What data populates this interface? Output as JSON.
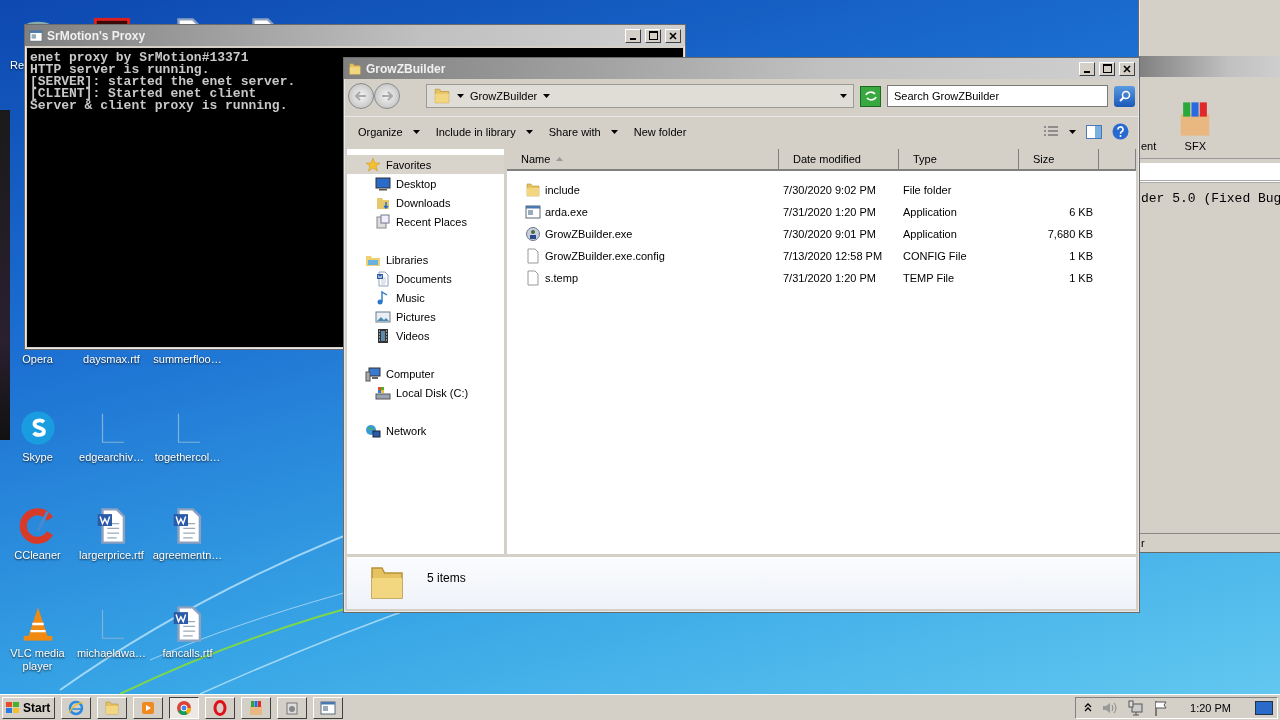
{
  "desktop": {
    "icons": [
      {
        "label": "Re",
        "kind": "recycle-bin"
      },
      {
        "kind": "app-red"
      },
      {
        "kind": "word"
      },
      {
        "kind": "word"
      },
      {
        "label": "Opera"
      },
      {
        "label": "daysmax.rtf"
      },
      {
        "label": "summerfloo…"
      },
      {
        "label": "Skype",
        "kind": "skype"
      },
      {
        "label": "edgearchiv…",
        "kind": "blank"
      },
      {
        "label": "togethercol…",
        "kind": "blank"
      },
      {
        "label": "CCleaner",
        "kind": "ccleaner"
      },
      {
        "label": "largerprice.rtf",
        "kind": "word"
      },
      {
        "label": "agreementn…",
        "kind": "word"
      },
      {
        "label": "VLC media player",
        "kind": "vlc"
      },
      {
        "label": "michaelawa…",
        "kind": "blank"
      },
      {
        "label": "fancalls.rtf",
        "kind": "word"
      }
    ]
  },
  "console_window": {
    "title": "SrMotion's Proxy",
    "lines": [
      "enet proxy by SrMotion#13371",
      "HTTP server is running.",
      "[SERVER]: started the enet server.",
      "[CLIENT]: Started enet client",
      "Server & client proxy is running."
    ]
  },
  "background_window": {
    "toolbar_labels": [
      "ent",
      "SFX"
    ],
    "content_line": "der 5.0 (Fixed Bug",
    "status": "r"
  },
  "explorer": {
    "title": "GrowZBuilder",
    "address": {
      "crumbs": [
        "GrowZBuilder"
      ]
    },
    "search": {
      "placeholder": "Search GrowZBuilder"
    },
    "toolbar": [
      {
        "label": "Organize",
        "dropdown": true
      },
      {
        "label": "Include in library",
        "dropdown": true
      },
      {
        "label": "Share with",
        "dropdown": true
      },
      {
        "label": "New folder",
        "dropdown": false
      }
    ],
    "nav": [
      {
        "label": "Favorites",
        "kind": "star",
        "selected": true,
        "children": [
          {
            "label": "Desktop",
            "kind": "desktop",
            "selected": false
          },
          {
            "label": "Downloads",
            "kind": "downloads",
            "selected": false
          },
          {
            "label": "Recent Places",
            "kind": "recent",
            "selected": false
          }
        ]
      },
      {
        "label": "Libraries",
        "kind": "libraries",
        "selected": false,
        "children": [
          {
            "label": "Documents",
            "kind": "documents",
            "selected": false
          },
          {
            "label": "Music",
            "kind": "music",
            "selected": false
          },
          {
            "label": "Pictures",
            "kind": "pictures",
            "selected": false
          },
          {
            "label": "Videos",
            "kind": "videos",
            "selected": false
          }
        ]
      },
      {
        "label": "Computer",
        "kind": "computer",
        "selected": false,
        "children": [
          {
            "label": "Local Disk (C:)",
            "kind": "disk",
            "selected": false
          }
        ]
      },
      {
        "label": "Network",
        "kind": "network",
        "selected": false
      }
    ],
    "columns": [
      {
        "label": "Name",
        "sorted": true
      },
      {
        "label": "Date modified",
        "sorted": false
      },
      {
        "label": "Type",
        "sorted": false
      },
      {
        "label": "Size",
        "sorted": false
      }
    ],
    "rows": [
      {
        "name": "include",
        "date": "7/30/2020 9:02 PM",
        "type": "File folder",
        "kind": "folder",
        "selected": false
      },
      {
        "name": "arda.exe",
        "date": "7/31/2020 1:20 PM",
        "type": "Application",
        "size": "6 KB",
        "kind": "exe-window",
        "selected": false
      },
      {
        "name": "GrowZBuilder.exe",
        "date": "7/30/2020 9:01 PM",
        "type": "Application",
        "size": "7,680 KB",
        "kind": "exe-app",
        "selected": false
      },
      {
        "name": "GrowZBuilder.exe.config",
        "date": "7/13/2020 12:58 PM",
        "type": "CONFIG File",
        "size": "1 KB",
        "kind": "file",
        "selected": false
      },
      {
        "name": "s.temp",
        "date": "7/31/2020 1:20 PM",
        "type": "TEMP File",
        "size": "1 KB",
        "kind": "file",
        "selected": false
      }
    ],
    "status": "5 items"
  },
  "taskbar": {
    "start": "Start",
    "apps": [
      {
        "kind": "ie",
        "selected": false
      },
      {
        "kind": "explorer",
        "selected": false
      },
      {
        "kind": "media",
        "selected": false
      },
      {
        "kind": "chrome",
        "selected": true
      },
      {
        "kind": "opera",
        "selected": false
      },
      {
        "kind": "winrar",
        "selected": false
      },
      {
        "kind": "app",
        "selected": false
      },
      {
        "kind": "app2",
        "selected": false
      }
    ],
    "clock": "1:20 PM"
  }
}
